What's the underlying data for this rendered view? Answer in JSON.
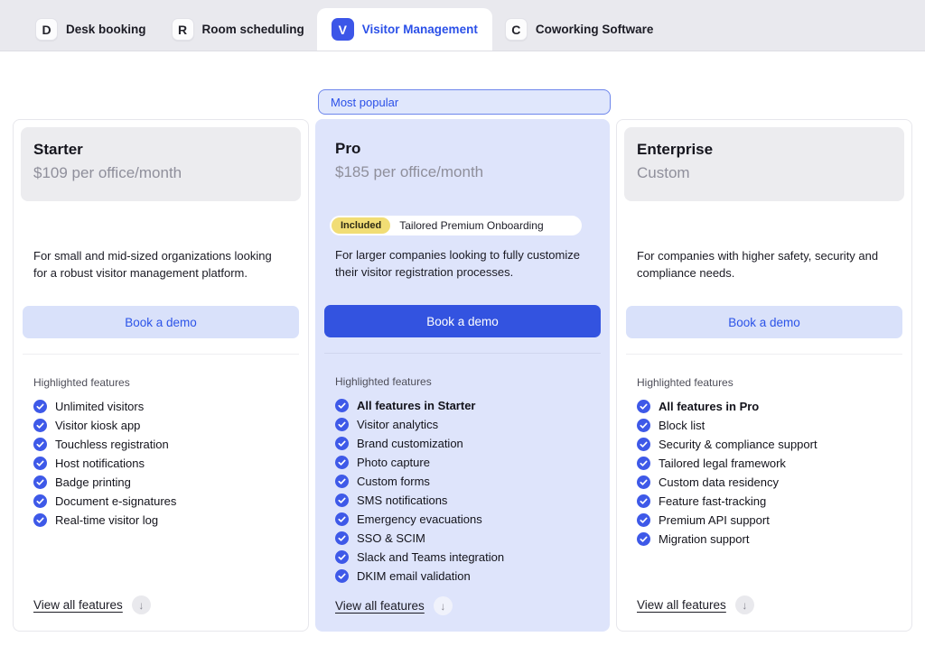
{
  "tab_bar": {
    "active_tab": "Visitor Management",
    "tabs": [
      {
        "letter": "D",
        "label": "Desk booking"
      },
      {
        "letter": "R",
        "label": "Room scheduling"
      },
      {
        "letter": "V",
        "label": "Visitor Management"
      },
      {
        "letter": "C",
        "label": "Coworking Software"
      }
    ]
  },
  "most_popular_badge": "Most popular",
  "icons": {
    "down_arrow_glyph": "↓"
  },
  "colors": {
    "accent_blue": "#3353e0",
    "pro_card_bg": "#dee4fb",
    "badge_yellow": "#f1dd75",
    "light_button_bg": "#d9e1fa"
  },
  "plans": [
    {
      "name": "Starter",
      "price": "$109 per office/month",
      "description": "For small and mid-sized organizations looking for a robust visitor management platform.",
      "cta_label": "Book a demo",
      "features_heading": "Highlighted features",
      "features": [
        {
          "text": "Unlimited visitors",
          "bold": false
        },
        {
          "text": "Visitor kiosk app",
          "bold": false
        },
        {
          "text": "Touchless registration",
          "bold": false
        },
        {
          "text": "Host notifications",
          "bold": false
        },
        {
          "text": "Badge printing",
          "bold": false
        },
        {
          "text": "Document e-signatures",
          "bold": false
        },
        {
          "text": "Real-time visitor log",
          "bold": false
        }
      ],
      "view_all_label": "View all features"
    },
    {
      "name": "Pro",
      "price": "$185 per office/month",
      "included_badge": "Included",
      "included_text": "Tailored Premium Onboarding",
      "description": "For larger companies looking to fully customize their visitor registration processes.",
      "cta_label": "Book a demo",
      "features_heading": "Highlighted features",
      "features": [
        {
          "text": "All features in Starter",
          "bold": true
        },
        {
          "text": "Visitor analytics",
          "bold": false
        },
        {
          "text": "Brand customization",
          "bold": false
        },
        {
          "text": "Photo capture",
          "bold": false
        },
        {
          "text": "Custom forms",
          "bold": false
        },
        {
          "text": "SMS notifications",
          "bold": false
        },
        {
          "text": "Emergency evacuations",
          "bold": false
        },
        {
          "text": "SSO & SCIM",
          "bold": false
        },
        {
          "text": "Slack and Teams integration",
          "bold": false
        },
        {
          "text": "DKIM email validation",
          "bold": false
        }
      ],
      "view_all_label": "View all features"
    },
    {
      "name": "Enterprise",
      "price": "Custom",
      "description": "For companies with higher safety, security and compliance needs.",
      "cta_label": "Book a demo",
      "features_heading": "Highlighted features",
      "features": [
        {
          "text": "All features in Pro",
          "bold": true
        },
        {
          "text": "Block list",
          "bold": false
        },
        {
          "text": "Security & compliance support",
          "bold": false
        },
        {
          "text": "Tailored legal framework",
          "bold": false
        },
        {
          "text": "Custom data residency",
          "bold": false
        },
        {
          "text": "Feature fast-tracking",
          "bold": false
        },
        {
          "text": "Premium API support",
          "bold": false
        },
        {
          "text": "Migration support",
          "bold": false
        }
      ],
      "view_all_label": "View all features"
    }
  ]
}
